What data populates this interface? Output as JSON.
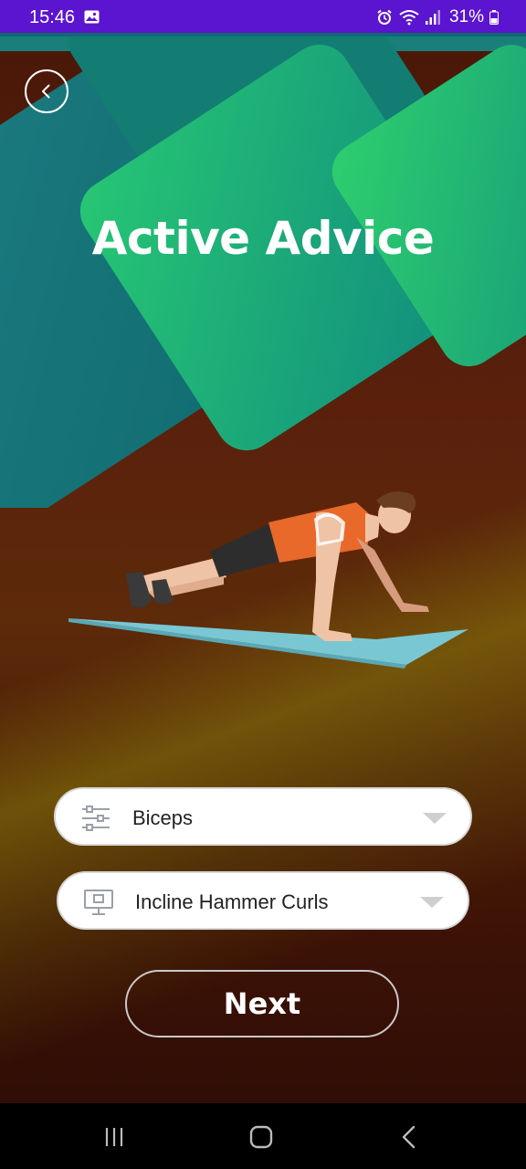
{
  "status_bar": {
    "time": "15:46",
    "battery": "31%",
    "icons": [
      "gallery-icon",
      "alarm-icon",
      "wifi-icon",
      "signal-icon",
      "battery-icon"
    ]
  },
  "header": {
    "title": "Active Advice",
    "back_icon": "chevron-left-icon"
  },
  "form": {
    "muscle": {
      "value": "Biceps",
      "icon": "sliders-icon",
      "arrow_icon": "dropdown-arrow-icon"
    },
    "exercise": {
      "value": "Incline Hammer Curls",
      "icon": "monitor-icon",
      "arrow_icon": "dropdown-arrow-icon"
    },
    "next_label": "Next"
  },
  "nav_bar": {
    "buttons": [
      "recent-apps-icon",
      "home-icon",
      "back-icon"
    ]
  },
  "colors": {
    "status_bar": "#5b14cf",
    "teal_shape": "#1a9a80",
    "background": "#4a1808",
    "mat": "#7ac7d4",
    "shirt": "#e8692a"
  }
}
